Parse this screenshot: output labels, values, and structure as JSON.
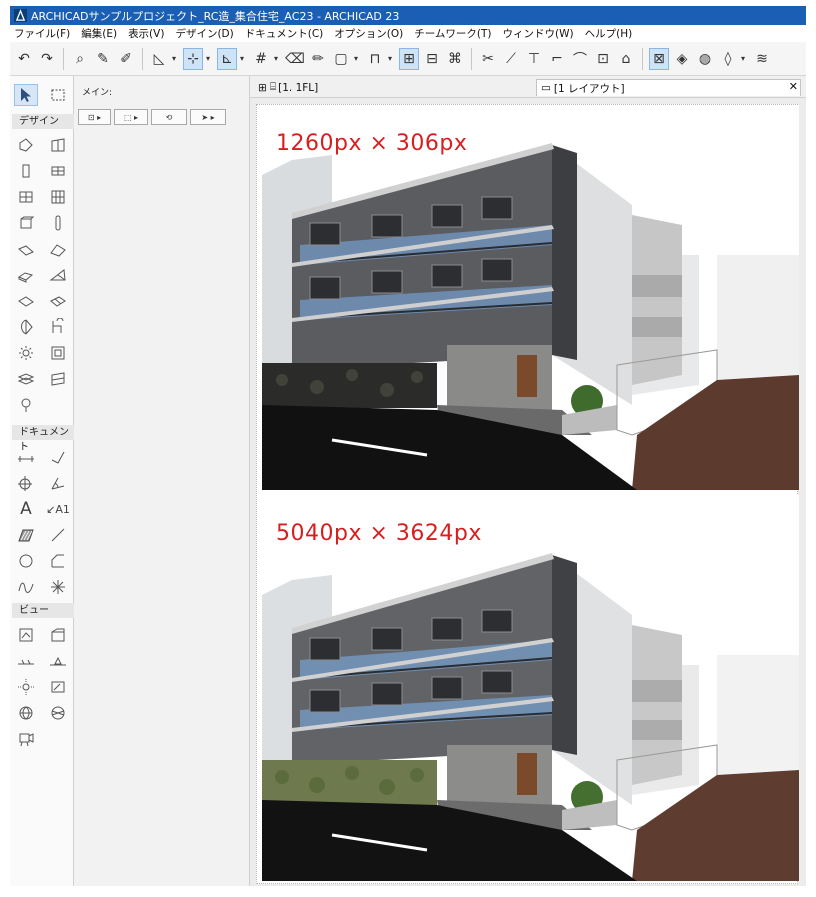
{
  "window": {
    "title": "ARCHICADサンプルプロジェクト_RC造_集合住宅_AC23 - ARCHICAD 23"
  },
  "menu": [
    "ファイル(F)",
    "編集(E)",
    "表示(V)",
    "デザイン(D)",
    "ドキュメント(C)",
    "オプション(O)",
    "チームワーク(T)",
    "ウィンドウ(W)",
    "ヘルプ(H)"
  ],
  "toolbox": {
    "sections": {
      "design": "デザイン",
      "document": "ドキュメント",
      "view": "ビュー"
    },
    "text_tool_glyph": "A",
    "label_tool_text": "A1",
    "design_tools": [
      "wall-tool",
      "curtain-wall-tool",
      "column-tool",
      "beam-tool",
      "window-tool",
      "door-tool",
      "object-tool",
      "lamp-tool",
      "slab-tool",
      "roof-tool",
      "shell-tool",
      "mesh-tool",
      "stair-tool",
      "railing-tool",
      "zone-tool",
      "morph-tool"
    ],
    "document_tools": [
      "dimension-tool",
      "level-dimension-tool",
      "radial-dimension-tool",
      "angle-dimension-tool",
      "text-tool",
      "label-tool",
      "fill-tool",
      "line-tool",
      "circle-tool",
      "polyline-tool",
      "spline-tool",
      "hotspot-tool"
    ],
    "view_tools": [
      "section-tool",
      "elevation-tool",
      "interior-elevation-tool",
      "worksheet-tool",
      "detail-tool",
      "change-tool",
      "camera-tool"
    ]
  },
  "infobox": {
    "label": "メイン:"
  },
  "tabs": [
    {
      "label": "[1. 1FL]"
    },
    {
      "label": "[1 レイアウト]"
    }
  ],
  "renders": [
    {
      "label": "1260px × 306px"
    },
    {
      "label": "5040px × 3624px"
    }
  ],
  "colors": {
    "titlebar": "#1a5fb4",
    "label_red": "#d71f1f",
    "toolbar_active": "#cfe3f7",
    "facade_gray": "#5a5c60",
    "glass_blue": "#6f8fb6",
    "deck_brown": "#5c3a2e"
  }
}
